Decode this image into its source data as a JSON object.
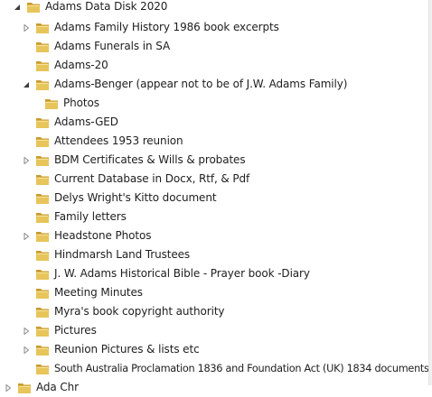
{
  "tree": {
    "root": {
      "label": "Adams Data Disk 2020",
      "expander": "expanded"
    },
    "items": [
      {
        "label": "Adams Family History 1986 book excerpts",
        "expander": "collapsed"
      },
      {
        "label": "Adams Funerals in SA",
        "expander": "none"
      },
      {
        "label": "Adams-20",
        "expander": "none"
      },
      {
        "label": "Adams-Benger (appear not  to be of J.W. Adams Family)",
        "expander": "expanded"
      },
      {
        "label": "Photos",
        "expander": "none",
        "child": true
      },
      {
        "label": "Adams-GED",
        "expander": "none"
      },
      {
        "label": "Attendees 1953 reunion",
        "expander": "none"
      },
      {
        "label": "BDM Certificates & Wills & probates",
        "expander": "collapsed"
      },
      {
        "label": "Current Database in Docx, Rtf, & Pdf",
        "expander": "none"
      },
      {
        "label": "Delys Wright's Kitto document",
        "expander": "none"
      },
      {
        "label": "Family letters",
        "expander": "none"
      },
      {
        "label": "Headstone Photos",
        "expander": "collapsed"
      },
      {
        "label": "Hindmarsh Land Trustees",
        "expander": "none"
      },
      {
        "label": "J. W. Adams Historical Bible - Prayer book -Diary",
        "expander": "none"
      },
      {
        "label": "Meeting Minutes",
        "expander": "none"
      },
      {
        "label": "Myra's book copyright authority",
        "expander": "none"
      },
      {
        "label": "Pictures",
        "expander": "collapsed"
      },
      {
        "label": "Reunion Pictures & lists etc",
        "expander": "collapsed"
      },
      {
        "label": "South Australia Proclamation 1836 and Foundation Act (UK) 1834 documents",
        "expander": "none"
      }
    ],
    "last": {
      "label": "Ada Chr",
      "expander": "collapsed"
    }
  },
  "colors": {
    "folder": "#e7c55a",
    "folder_dark": "#c99a2e",
    "expander": "#8a8a8a"
  },
  "icons": {
    "folder": "folder-icon",
    "expanded": "triangle-expanded-icon",
    "collapsed": "triangle-collapsed-icon"
  }
}
